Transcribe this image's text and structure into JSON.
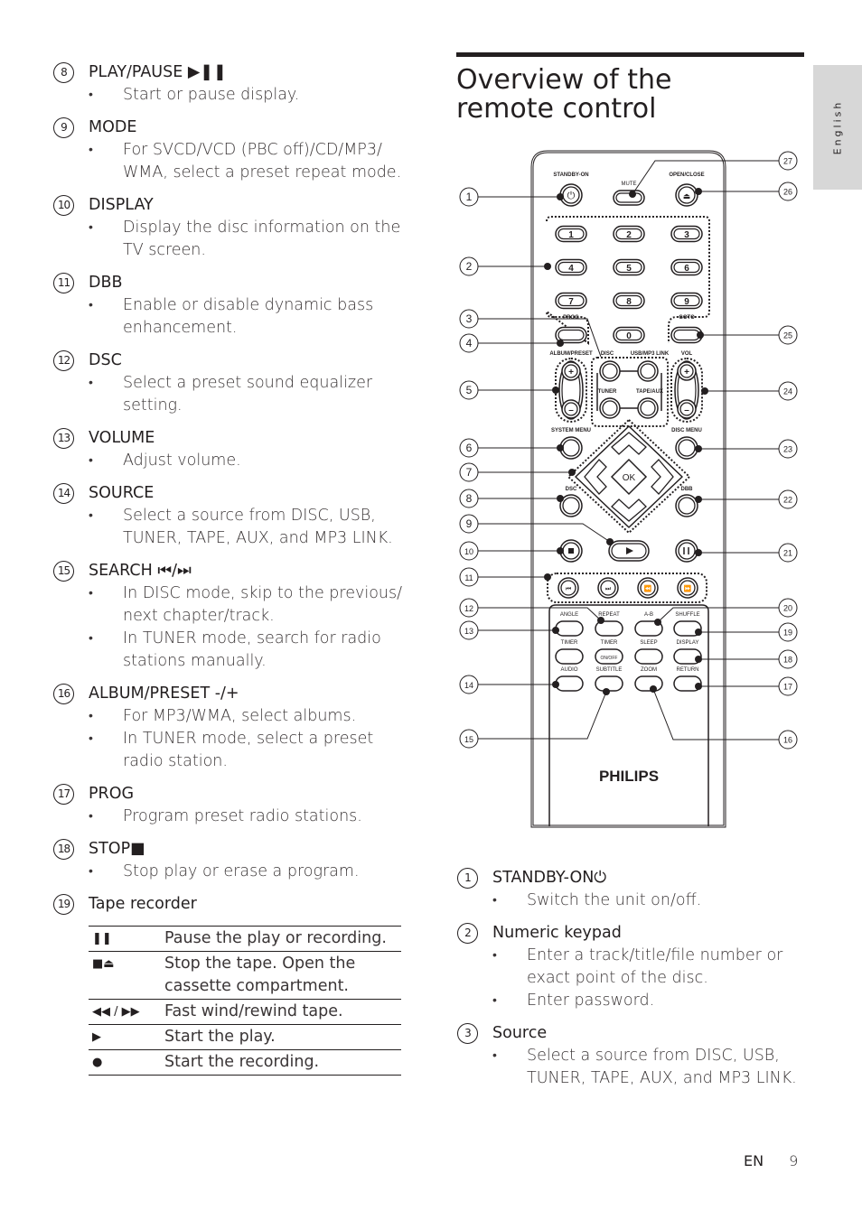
{
  "sidebar_tab": {
    "label": "English"
  },
  "left_items": [
    {
      "n": "8",
      "title": "PLAY/PAUSE ▶❚❚",
      "bullets": [
        "Start or pause display."
      ]
    },
    {
      "n": "9",
      "title": "MODE",
      "bullets": [
        "For SVCD/VCD (PBC off)/CD/MP3/ WMA, select a preset repeat mode."
      ]
    },
    {
      "n": "10",
      "title": "DISPLAY",
      "bullets": [
        "Display the disc information on the TV screen."
      ]
    },
    {
      "n": "11",
      "title": "DBB",
      "bullets": [
        "Enable or disable dynamic bass enhancement."
      ]
    },
    {
      "n": "12",
      "title": "DSC",
      "bullets": [
        "Select a preset sound equalizer setting."
      ]
    },
    {
      "n": "13",
      "title": " VOLUME",
      "bullets": [
        "Adjust volume."
      ]
    },
    {
      "n": "14",
      "title": "SOURCE",
      "bullets": [
        "Select a source from DISC, USB, TUNER, TAPE, AUX, and MP3 LINK."
      ]
    },
    {
      "n": "15",
      "title": "SEARCH ⏮/⏭",
      "bullets": [
        "In DISC mode, skip to the previous/ next chapter/track.",
        "In TUNER mode, search for radio stations manually."
      ]
    },
    {
      "n": "16",
      "title": "ALBUM/PRESET -/+",
      "bullets": [
        "For MP3/WMA, select albums.",
        "In TUNER mode, select a preset radio station."
      ]
    },
    {
      "n": "17",
      "title": "PROG",
      "bullets": [
        "Program preset radio stations."
      ]
    },
    {
      "n": "18",
      "title": "STOP■",
      "bullets": [
        "Stop play or erase a program."
      ]
    },
    {
      "n": "19",
      "title": "Tape recorder",
      "bullets": []
    }
  ],
  "tape_table": [
    {
      "symbol": "❚❚",
      "desc": "Pause the play or recording."
    },
    {
      "symbol": "■⏏",
      "desc": "Stop the tape. Open the cassette compartment."
    },
    {
      "symbol": "◀◀ / ▶▶",
      "desc": "Fast wind/rewind tape."
    },
    {
      "symbol": "▶",
      "desc": "Start the play."
    },
    {
      "symbol": "●",
      "desc": "Start the recording."
    }
  ],
  "section": {
    "title": "Overview of the remote control"
  },
  "remote": {
    "brand": "PHILIPS",
    "labels": {
      "standby": "STANDBY-ON",
      "mute": "MUTE",
      "open_close": "OPEN/CLOSE",
      "prog": "PROG",
      "goto": "GOTO",
      "album_preset": "ALBUM/PRESET",
      "disc": "DISC",
      "usb_mp3": "USB/MP3 LINK",
      "vol": "VOL",
      "tuner": "TUNER",
      "tape_aux": "TAPE/AUX",
      "system_menu": "SYSTEM MENU",
      "disc_menu": "DISC MENU",
      "dsc": "DSC",
      "dbb": "DBB",
      "ok": "OK",
      "angle": "ANGLE",
      "repeat": "REPEAT",
      "ab": "A-B",
      "shuffle": "SHUFFLE",
      "timer": "TIMER",
      "timer2": "TIMER",
      "sleep": "SLEEP",
      "display": "DISPLAY",
      "onoff": "ON/OFF",
      "audio": "AUDIO",
      "subtitle": "SUBTITLE",
      "zoom": "ZOOM",
      "return": "RETURN",
      "plus": "+",
      "minus": "–"
    },
    "digits": [
      "1",
      "2",
      "3",
      "4",
      "5",
      "6",
      "7",
      "8",
      "9",
      "0"
    ],
    "callouts_left": [
      "1",
      "2",
      "3",
      "4",
      "5",
      "6",
      "7",
      "8",
      "9",
      "10",
      "11",
      "12",
      "13",
      "14",
      "15"
    ],
    "callouts_right": [
      "27",
      "26",
      "25",
      "24",
      "23",
      "22",
      "21",
      "20",
      "19",
      "18",
      "17",
      "16"
    ]
  },
  "bottom_items": [
    {
      "n": "1",
      "title": "STANDBY-ON⏻",
      "bullets": [
        "Switch the unit on/off."
      ]
    },
    {
      "n": "2",
      "title": "Numeric keypad",
      "bullets": [
        "Enter a track/title/file number or exact point of the disc.",
        "Enter password."
      ]
    },
    {
      "n": "3",
      "title": "Source",
      "bullets": [
        "Select a source from DISC, USB, TUNER, TAPE, AUX, and MP3 LINK."
      ]
    }
  ],
  "footer": {
    "lang": "EN",
    "page": "9"
  }
}
